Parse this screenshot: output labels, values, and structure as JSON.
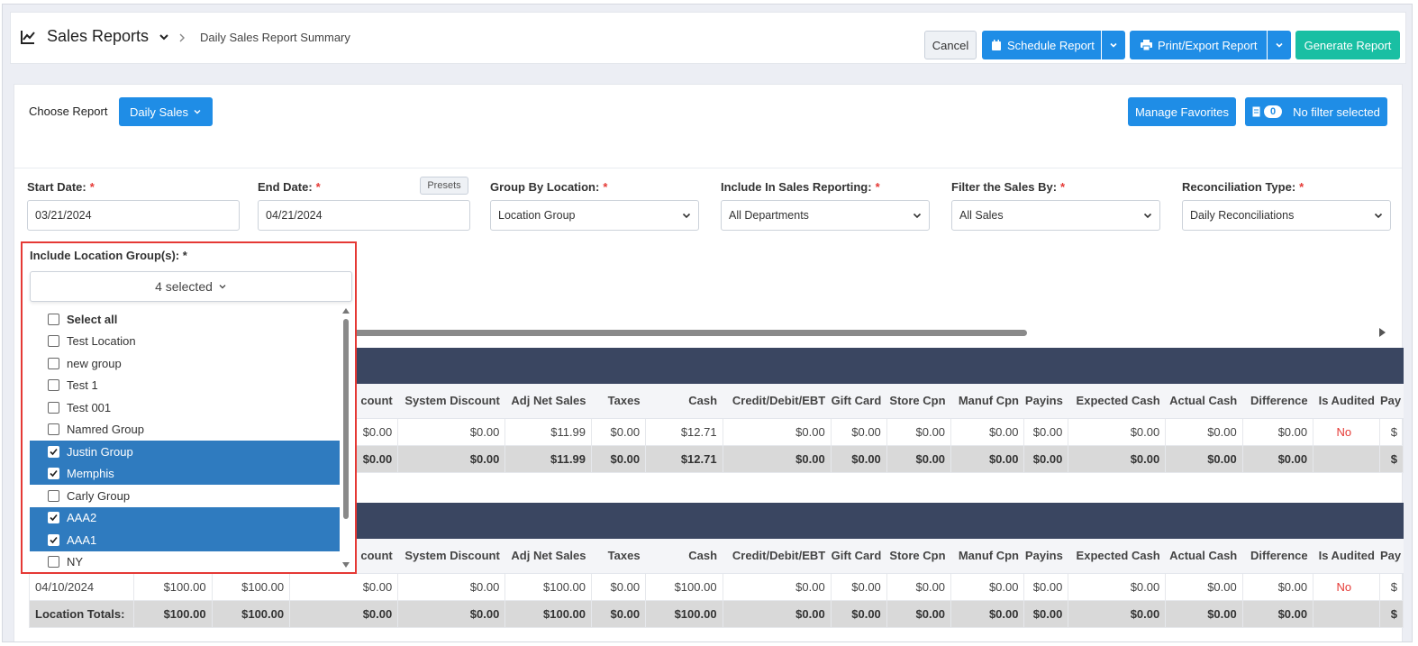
{
  "header": {
    "title": "Sales Reports",
    "breadcrumb": "Daily Sales Report Summary",
    "cancel_label": "Cancel",
    "schedule_label": "Schedule Report",
    "print_label": "Print/Export Report",
    "generate_label": "Generate Report"
  },
  "toolbar": {
    "choose_report_label": "Choose Report",
    "report_selected": "Daily Sales",
    "manage_favorites_label": "Manage Favorites",
    "filter_count": "0",
    "filter_label": "No filter selected"
  },
  "filters": {
    "start_date_label": "Start Date:",
    "start_date_value": "03/21/2024",
    "end_date_label": "End Date:",
    "end_date_value": "04/21/2024",
    "presets_label": "Presets",
    "group_by_label": "Group By Location:",
    "group_by_value": "Location Group",
    "include_reporting_label": "Include In Sales Reporting:",
    "include_reporting_value": "All Departments",
    "filter_sales_label": "Filter the Sales By:",
    "filter_sales_value": "All Sales",
    "reconciliation_label": "Reconciliation Type:",
    "reconciliation_value": "Daily Reconciliations",
    "required_mark": "*"
  },
  "location_dropdown": {
    "label": "Include Location Group(s): *",
    "summary": "4 selected",
    "items": [
      {
        "label": "Select all",
        "checked": false
      },
      {
        "label": "Test Location",
        "checked": false
      },
      {
        "label": "new group",
        "checked": false
      },
      {
        "label": "Test 1",
        "checked": false
      },
      {
        "label": "Test 001",
        "checked": false
      },
      {
        "label": "Namred Group",
        "checked": false
      },
      {
        "label": "Justin Group",
        "checked": true
      },
      {
        "label": "Memphis",
        "checked": true
      },
      {
        "label": "Carly Group",
        "checked": false
      },
      {
        "label": "AAA2",
        "checked": true
      },
      {
        "label": "AAA1",
        "checked": true
      },
      {
        "label": "NY",
        "checked": false
      }
    ]
  },
  "table1": {
    "columns": [
      "",
      "",
      "",
      "count",
      "System Discount",
      "Adj Net Sales",
      "Taxes",
      "Cash",
      "Credit/Debit/EBT",
      "Gift Card",
      "Store Cpn",
      "Manuf Cpn",
      "Payins",
      "Expected Cash",
      "Actual Cash",
      "Difference",
      "Is Audited",
      "Pay"
    ],
    "row": [
      "",
      "",
      "",
      "$0.00",
      "$0.00",
      "$11.99",
      "$0.00",
      "$12.71",
      "$0.00",
      "$0.00",
      "$0.00",
      "$0.00",
      "$0.00",
      "$0.00",
      "$0.00",
      "$0.00",
      "No",
      "$"
    ],
    "total": [
      "",
      "",
      "",
      "$0.00",
      "$0.00",
      "$11.99",
      "$0.00",
      "$12.71",
      "$0.00",
      "$0.00",
      "$0.00",
      "$0.00",
      "$0.00",
      "$0.00",
      "$0.00",
      "$0.00",
      "",
      "$"
    ]
  },
  "table2": {
    "columns": [
      "",
      "",
      "",
      "count",
      "System Discount",
      "Adj Net Sales",
      "Taxes",
      "Cash",
      "Credit/Debit/EBT",
      "Gift Card",
      "Store Cpn",
      "Manuf Cpn",
      "Payins",
      "Expected Cash",
      "Actual Cash",
      "Difference",
      "Is Audited",
      "Pay"
    ],
    "row": [
      "04/10/2024",
      "$100.00",
      "$100.00",
      "$0.00",
      "$0.00",
      "$100.00",
      "$0.00",
      "$100.00",
      "$0.00",
      "$0.00",
      "$0.00",
      "$0.00",
      "$0.00",
      "$0.00",
      "$0.00",
      "$0.00",
      "No",
      "$"
    ],
    "total": [
      "Location Totals:",
      "$100.00",
      "$100.00",
      "$0.00",
      "$0.00",
      "$100.00",
      "$0.00",
      "$100.00",
      "$0.00",
      "$0.00",
      "$0.00",
      "$0.00",
      "$0.00",
      "$0.00",
      "$0.00",
      "$0.00",
      "",
      "$"
    ]
  },
  "colors": {
    "primary": "#1f8de6",
    "teal": "#19bfa3",
    "band": "#3a4661",
    "highlight": "#e53935",
    "selected_row": "#2f7bbf"
  }
}
